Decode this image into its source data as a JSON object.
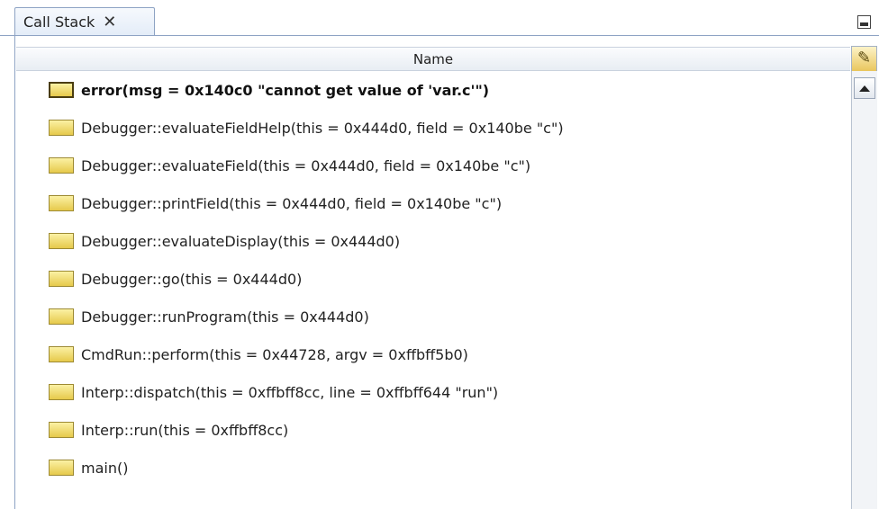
{
  "tab": {
    "title": "Call Stack",
    "close_glyph": "✕"
  },
  "table": {
    "column_name": "Name",
    "column_selector_icon": "column-selector-icon"
  },
  "frames": [
    {
      "label": "error(msg = 0x140c0 \"cannot get value of 'var.c'\")",
      "current": true
    },
    {
      "label": "Debugger::evaluateFieldHelp(this = 0x444d0, field = 0x140be \"c\")",
      "current": false
    },
    {
      "label": "Debugger::evaluateField(this = 0x444d0, field = 0x140be \"c\")",
      "current": false
    },
    {
      "label": "Debugger::printField(this = 0x444d0, field = 0x140be \"c\")",
      "current": false
    },
    {
      "label": "Debugger::evaluateDisplay(this = 0x444d0)",
      "current": false
    },
    {
      "label": "Debugger::go(this = 0x444d0)",
      "current": false
    },
    {
      "label": "Debugger::runProgram(this = 0x444d0)",
      "current": false
    },
    {
      "label": "CmdRun::perform(this = 0x44728, argv = 0xffbff5b0)",
      "current": false
    },
    {
      "label": "Interp::dispatch(this = 0xffbff8cc, line = 0xffbff644 \"run\")",
      "current": false
    },
    {
      "label": "Interp::run(this = 0xffbff8cc)",
      "current": false
    },
    {
      "label": "main()",
      "current": false
    }
  ]
}
